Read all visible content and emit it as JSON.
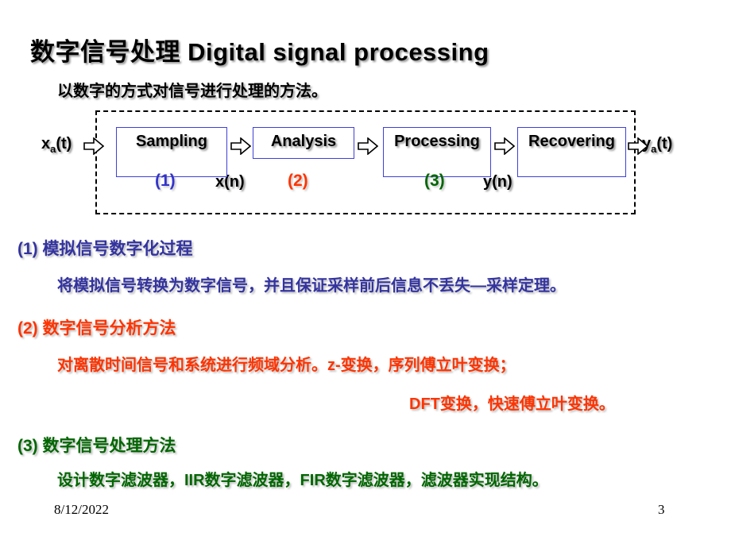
{
  "slide": {
    "title": "数字信号处理 Digital signal processing",
    "subtitle": "以数字的方式对信号进行处理的方法。"
  },
  "diagram": {
    "input_signal": "x",
    "input_signal_sub": "a",
    "input_signal_tail": "(t)",
    "output_signal": "y",
    "output_signal_sub": "a",
    "output_signal_tail": "(t)",
    "intermediate_xn": "x(n)",
    "intermediate_yn": "y(n)",
    "blocks": [
      {
        "label": "Sampling",
        "step": "(1)",
        "step_color": "#3333cc"
      },
      {
        "label": "Analysis",
        "step": "(2)",
        "step_color": "#ff3300"
      },
      {
        "label": "Processing",
        "step": "(3)",
        "step_color": "#006600"
      },
      {
        "label": "Recovering",
        "step": "",
        "step_color": ""
      }
    ]
  },
  "sections": [
    {
      "heading": "(1) 模拟信号数字化过程",
      "color": "#3333a0",
      "lines": [
        "将模拟信号转换为数字信号，并且保证采样前后信息不丢失—采样定理。"
      ]
    },
    {
      "heading": "(2) 数字信号分析方法",
      "color": "#ff3300",
      "lines": [
        "对离散时间信号和系统进行频域分析。z-变换，序列傅立叶变换；",
        "DFT变换，快速傅立叶变换。"
      ]
    },
    {
      "heading": "(3) 数字信号处理方法",
      "color": "#006600",
      "lines": [
        "设计数字滤波器，IIR数字滤波器，FIR数字滤波器，滤波器实现结构。"
      ]
    }
  ],
  "footer": {
    "date": "8/12/2022",
    "page_number": "3"
  }
}
